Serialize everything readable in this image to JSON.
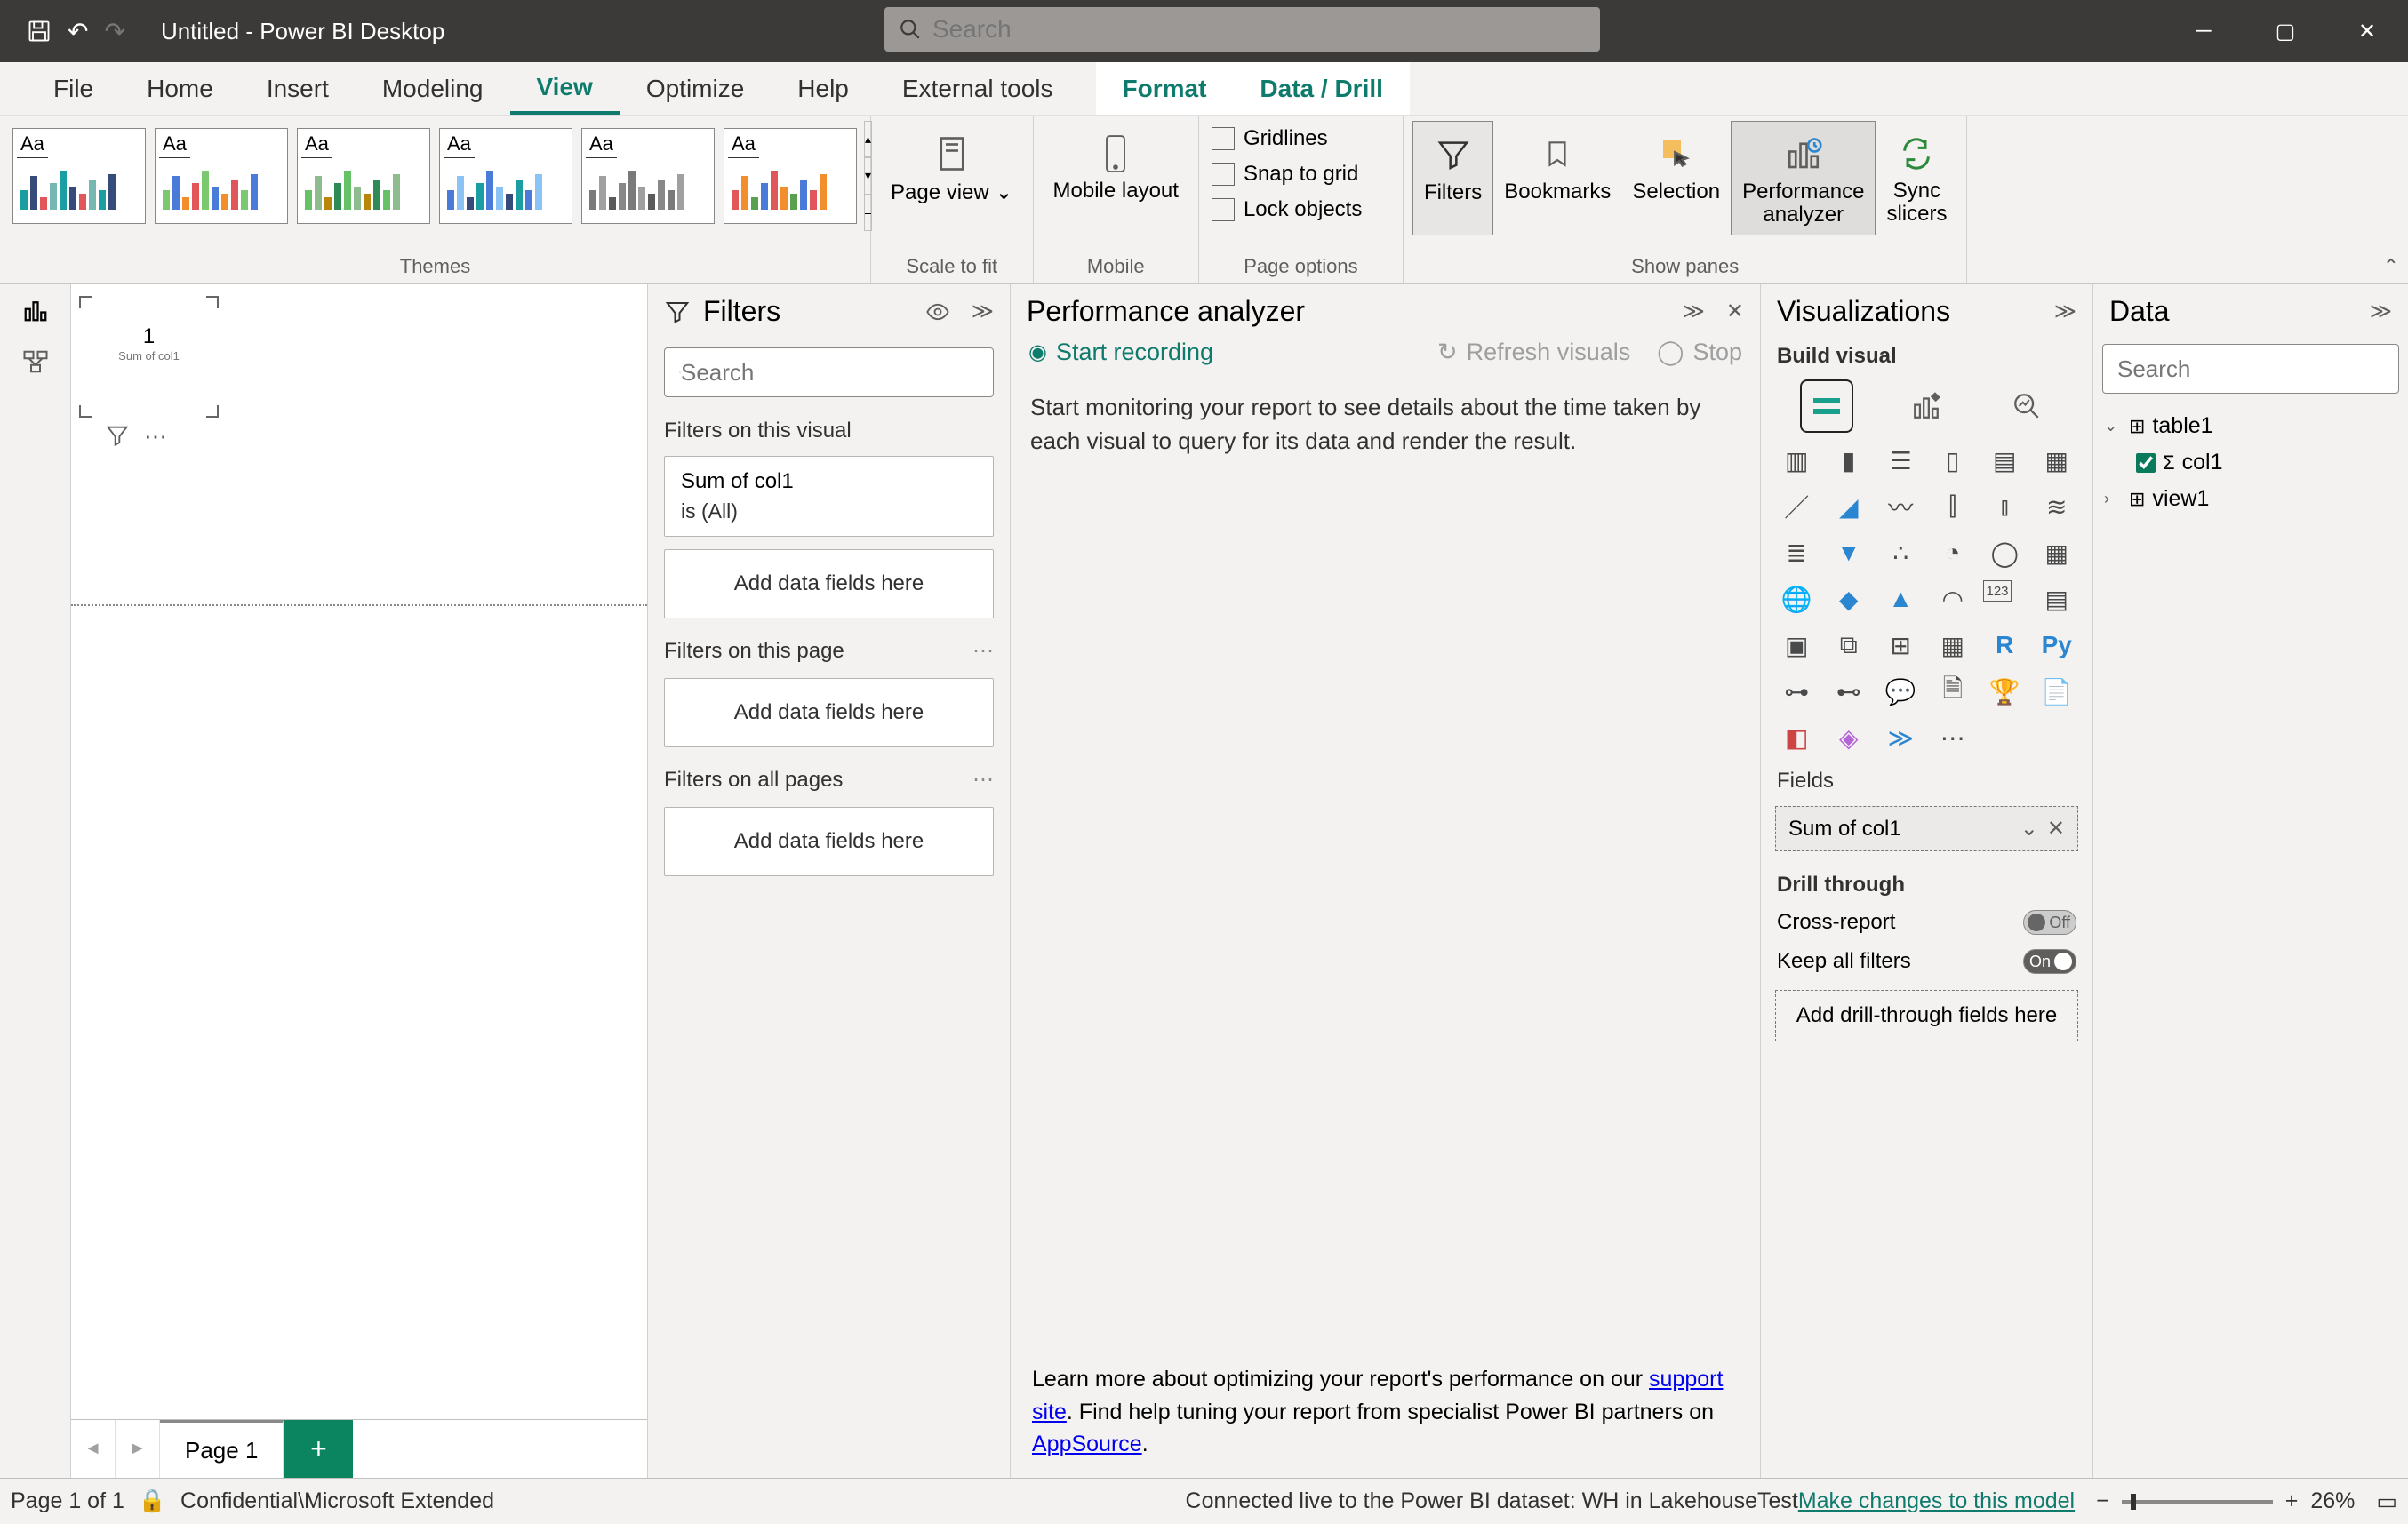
{
  "titlebar": {
    "title": "Untitled - Power BI Desktop",
    "search_placeholder": "Search"
  },
  "menu": {
    "tabs": [
      "File",
      "Home",
      "Insert",
      "Modeling",
      "View",
      "Optimize",
      "Help",
      "External tools",
      "Format",
      "Data / Drill"
    ],
    "active": "View",
    "contextual": [
      "Format",
      "Data / Drill"
    ]
  },
  "ribbon": {
    "groups": {
      "themes": "Themes",
      "scale": "Scale to fit",
      "mobile": "Mobile",
      "pageopts": "Page options",
      "panes": "Show panes"
    },
    "page_view": "Page view",
    "mobile_layout": "Mobile layout",
    "gridlines": "Gridlines",
    "snap": "Snap to grid",
    "lock": "Lock objects",
    "filters": "Filters",
    "bookmarks": "Bookmarks",
    "selection": "Selection",
    "perf": "Performance analyzer",
    "sync": "Sync slicers"
  },
  "canvas": {
    "value": "1",
    "label": "Sum of col1"
  },
  "pagetab": "Page 1",
  "filters": {
    "title": "Filters",
    "search_placeholder": "Search",
    "section_visual": "Filters on this visual",
    "section_page": "Filters on this page",
    "section_all": "Filters on all pages",
    "card_title": "Sum of col1",
    "card_sub": "is (All)",
    "drop": "Add data fields here"
  },
  "perf": {
    "title": "Performance analyzer",
    "start": "Start recording",
    "refresh": "Refresh visuals",
    "stop": "Stop",
    "body": "Start monitoring your report to see details about the time taken by each visual to query for its data and render the result.",
    "learn1": "Learn more about optimizing your report's performance on our ",
    "learn_link1": "support site",
    "learn2": ". Find help tuning your report from specialist Power BI partners on ",
    "learn_link2": "AppSource",
    "learn3": "."
  },
  "viz": {
    "title": "Visualizations",
    "build": "Build visual",
    "fields": "Fields",
    "fieldwell": "Sum of col1",
    "drill": "Drill through",
    "cross": "Cross-report",
    "cross_state": "Off",
    "keep": "Keep all filters",
    "keep_state": "On",
    "drillzone": "Add drill-through fields here"
  },
  "data": {
    "title": "Data",
    "search_placeholder": "Search",
    "table": "table1",
    "col": "col1",
    "view": "view1"
  },
  "status": {
    "page": "Page 1 of 1",
    "confidential": "Confidential\\Microsoft Extended",
    "conn": "Connected live to the Power BI dataset: WH in LakehouseTest ",
    "link": "Make changes to this model",
    "zoom": "26%"
  }
}
